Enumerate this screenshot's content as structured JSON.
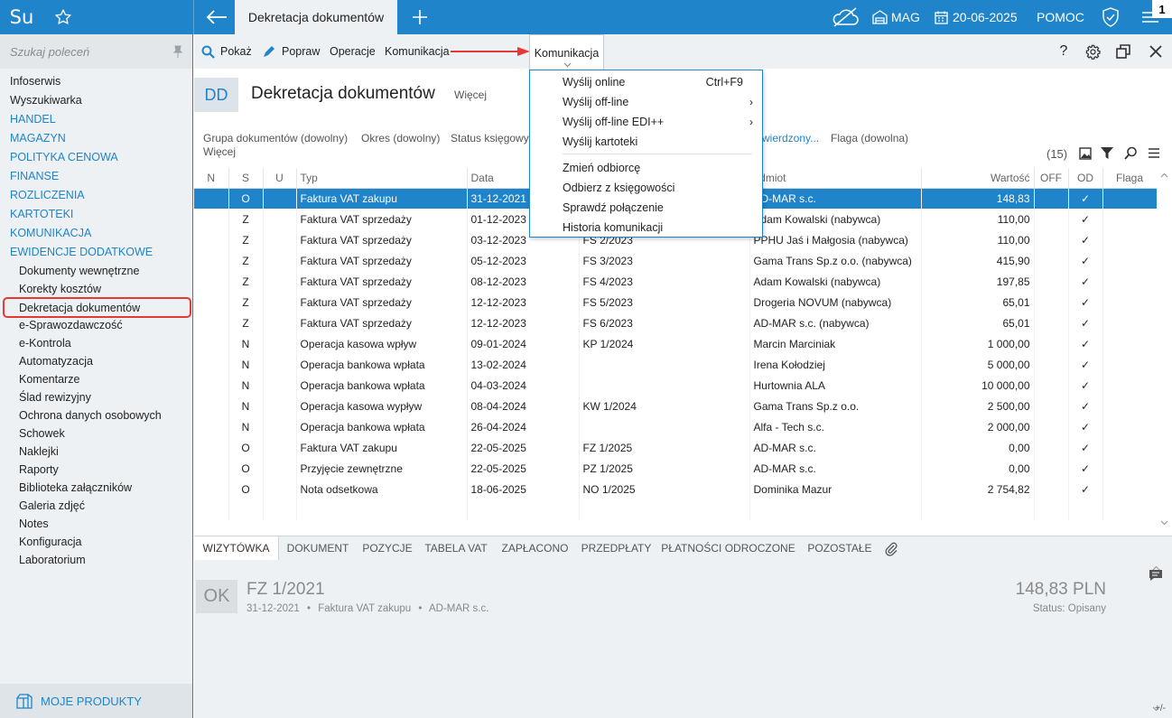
{
  "topbar": {
    "logo": "Su",
    "active_tab": "Dekretacja dokumentów",
    "mag": "MAG",
    "date": "20-06-2025",
    "help": "POMOC",
    "notif": "1"
  },
  "sidebar": {
    "search_placeholder": "Szukaj poleceń",
    "items": [
      {
        "label": "Infoserwis",
        "kind": "plain"
      },
      {
        "label": "Wyszukiwarka",
        "kind": "plain"
      },
      {
        "label": "HANDEL",
        "kind": "cat"
      },
      {
        "label": "MAGAZYN",
        "kind": "cat"
      },
      {
        "label": "POLITYKA CENOWA",
        "kind": "cat"
      },
      {
        "label": "FINANSE",
        "kind": "cat"
      },
      {
        "label": "ROZLICZENIA",
        "kind": "cat"
      },
      {
        "label": "KARTOTEKI",
        "kind": "cat"
      },
      {
        "label": "KOMUNIKACJA",
        "kind": "cat"
      },
      {
        "label": "EWIDENCJE DODATKOWE",
        "kind": "cat"
      },
      {
        "label": "Dokumenty wewnętrzne",
        "kind": "sub"
      },
      {
        "label": "Korekty kosztów",
        "kind": "sub"
      },
      {
        "label": "Dekretacja dokumentów",
        "kind": "hl"
      },
      {
        "label": "e-Sprawozdawczość",
        "kind": "sub"
      },
      {
        "label": "e-Kontrola",
        "kind": "sub"
      },
      {
        "label": "Automatyzacja",
        "kind": "sub"
      },
      {
        "label": "Komentarze",
        "kind": "sub"
      },
      {
        "label": "Ślad rewizyjny",
        "kind": "sub"
      },
      {
        "label": "Ochrona danych osobowych",
        "kind": "sub"
      },
      {
        "label": "Schowek",
        "kind": "sub"
      },
      {
        "label": "Naklejki",
        "kind": "sub"
      },
      {
        "label": "Raporty",
        "kind": "sub"
      },
      {
        "label": "Biblioteka załączników",
        "kind": "sub"
      },
      {
        "label": "Galeria zdjęć",
        "kind": "sub"
      },
      {
        "label": "Notes",
        "kind": "sub"
      },
      {
        "label": "Konfiguracja",
        "kind": "sub"
      },
      {
        "label": "Laboratorium",
        "kind": "sub"
      }
    ],
    "my_products": "MOJE PRODUKTY"
  },
  "toolbar": {
    "show": "Pokaż",
    "fix": "Popraw",
    "ops": "Operacje",
    "comm": "Komunikacja",
    "comm_tab": "Komunikacja",
    "help": "?"
  },
  "header": {
    "badge": "DD",
    "title": "Dekretacja dokumentów",
    "more": "Więcej"
  },
  "filters": {
    "group": "Grupa dokumentów (dowolny)",
    "period": "Okres (dowolny)",
    "status": "Status księgowy",
    "confirmed": "wierdzony...",
    "flag": "Flaga (dowolna)",
    "more": "Więcej",
    "count": "(15)"
  },
  "grid": {
    "columns": [
      "N",
      "S",
      "U",
      "Typ",
      "Data",
      "",
      "odmiot",
      "Wartość",
      "OFF",
      "OD",
      "Flaga"
    ],
    "rows": [
      {
        "s": "O",
        "typ": "Faktura VAT zakupu",
        "data": "31-12-2021",
        "num": "",
        "pod": "AD-MAR s.c.",
        "val": "148,83",
        "od": "✓",
        "sel": true
      },
      {
        "s": "Z",
        "typ": "Faktura VAT sprzedaży",
        "data": "01-12-2023",
        "num": "",
        "pod": "Adam Kowalski (nabywca)",
        "val": "110,00",
        "od": "✓"
      },
      {
        "s": "Z",
        "typ": "Faktura VAT sprzedaży",
        "data": "03-12-2023",
        "num": "FS 2/2023",
        "pod": "PPHU Jaś i Małgosia (nabywca)",
        "val": "110,00",
        "od": "✓"
      },
      {
        "s": "Z",
        "typ": "Faktura VAT sprzedaży",
        "data": "05-12-2023",
        "num": "FS 3/2023",
        "pod": "Gama Trans Sp.z o.o. (nabywca)",
        "val": "415,90",
        "od": "✓"
      },
      {
        "s": "Z",
        "typ": "Faktura VAT sprzedaży",
        "data": "08-12-2023",
        "num": "FS 4/2023",
        "pod": "Adam Kowalski (nabywca)",
        "val": "197,85",
        "od": "✓"
      },
      {
        "s": "Z",
        "typ": "Faktura VAT sprzedaży",
        "data": "12-12-2023",
        "num": "FS 5/2023",
        "pod": "Drogeria NOVUM (nabywca)",
        "val": "65,01",
        "od": "✓"
      },
      {
        "s": "Z",
        "typ": "Faktura VAT sprzedaży",
        "data": "12-12-2023",
        "num": "FS 6/2023",
        "pod": "AD-MAR s.c. (nabywca)",
        "val": "65,01",
        "od": "✓"
      },
      {
        "s": "N",
        "typ": "Operacja kasowa wpływ",
        "data": "09-01-2024",
        "num": "KP 1/2024",
        "pod": "Marcin Marciniak",
        "val": "1 000,00",
        "od": "✓"
      },
      {
        "s": "N",
        "typ": "Operacja bankowa wpłata",
        "data": "13-02-2024",
        "num": "",
        "pod": "Irena Kołodziej",
        "val": "5 000,00",
        "od": "✓"
      },
      {
        "s": "N",
        "typ": "Operacja bankowa wpłata",
        "data": "04-03-2024",
        "num": "",
        "pod": "Hurtownia ALA",
        "val": "10 000,00",
        "od": "✓"
      },
      {
        "s": "N",
        "typ": "Operacja kasowa wypływ",
        "data": "08-04-2024",
        "num": "KW 1/2024",
        "pod": "Gama Trans Sp.z o.o.",
        "val": "2 500,00",
        "od": "✓"
      },
      {
        "s": "N",
        "typ": "Operacja bankowa wpłata",
        "data": "26-04-2024",
        "num": "",
        "pod": "Alfa - Tech s.c.",
        "val": "2 000,00",
        "od": "✓"
      },
      {
        "s": "O",
        "typ": "Faktura VAT zakupu",
        "data": "22-05-2025",
        "num": "FZ 1/2025",
        "pod": "AD-MAR s.c.",
        "val": "0,00",
        "od": "✓"
      },
      {
        "s": "O",
        "typ": "Przyjęcie zewnętrzne",
        "data": "22-05-2025",
        "num": "PZ 1/2025",
        "pod": "AD-MAR s.c.",
        "val": "0,00",
        "od": "✓"
      },
      {
        "s": "O",
        "typ": "Nota odsetkowa",
        "data": "18-06-2025",
        "num": "NO 1/2025",
        "pod": "Dominika Mazur",
        "val": "2 754,82",
        "od": "✓"
      }
    ]
  },
  "bottom_tabs": [
    "WIZYTÓWKA",
    "DOKUMENT",
    "POZYCJE",
    "TABELA VAT",
    "ZAPŁACONO",
    "PRZEDPŁATY",
    "PŁATNOŚCI ODROCZONE",
    "POZOSTAŁE"
  ],
  "detail": {
    "badge": "OK",
    "number": "FZ 1/2021",
    "date": "31-12-2021",
    "type": "Faktura VAT zakupu",
    "party": "AD-MAR s.c.",
    "amount": "148,83 PLN",
    "status": "Status: Opisany",
    "plusminus": "+/-"
  },
  "menu": {
    "items": [
      {
        "label": "Wyślij online",
        "shortcut": "Ctrl+F9"
      },
      {
        "label": "Wyślij off-line",
        "arrow": "›"
      },
      {
        "label": "Wyślij off-line EDI++",
        "arrow": "›"
      },
      {
        "label": "Wyślij kartoteki"
      },
      {
        "label": "Zmień odbiorcę"
      },
      {
        "label": "Odbierz z księgowości"
      },
      {
        "label": "Sprawdź połączenie"
      },
      {
        "label": "Historia komunikacji"
      }
    ]
  },
  "colors": {
    "accent": "#1f84c9",
    "highlight": "#e53935",
    "arrow": "#e53935"
  }
}
